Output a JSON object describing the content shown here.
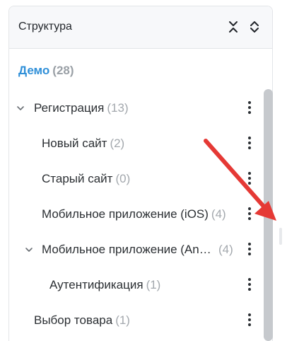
{
  "panel": {
    "title": "Структура",
    "collapse_all_icon": "collapse-all-icon",
    "expand_all_icon": "expand-all-icon"
  },
  "tree": {
    "root": {
      "name": "Демо",
      "count": "(28)"
    },
    "items": [
      {
        "label": "Регистрация",
        "count": "(13)",
        "expanded": true
      },
      {
        "label": "Новый сайт",
        "count": "(2)"
      },
      {
        "label": "Старый сайт",
        "count": "(0)"
      },
      {
        "label": "Мобильное приложение (iOS)",
        "count": "(4)"
      },
      {
        "label": "Мобильное приложение (Android)",
        "count": "(4)",
        "expanded": true
      },
      {
        "label": "Аутентификация",
        "count": "(1)"
      },
      {
        "label": "Выбор товара",
        "count": "(1)"
      }
    ]
  },
  "colors": {
    "accent": "#2f8fd8",
    "annotation_arrow": "#e53935"
  }
}
